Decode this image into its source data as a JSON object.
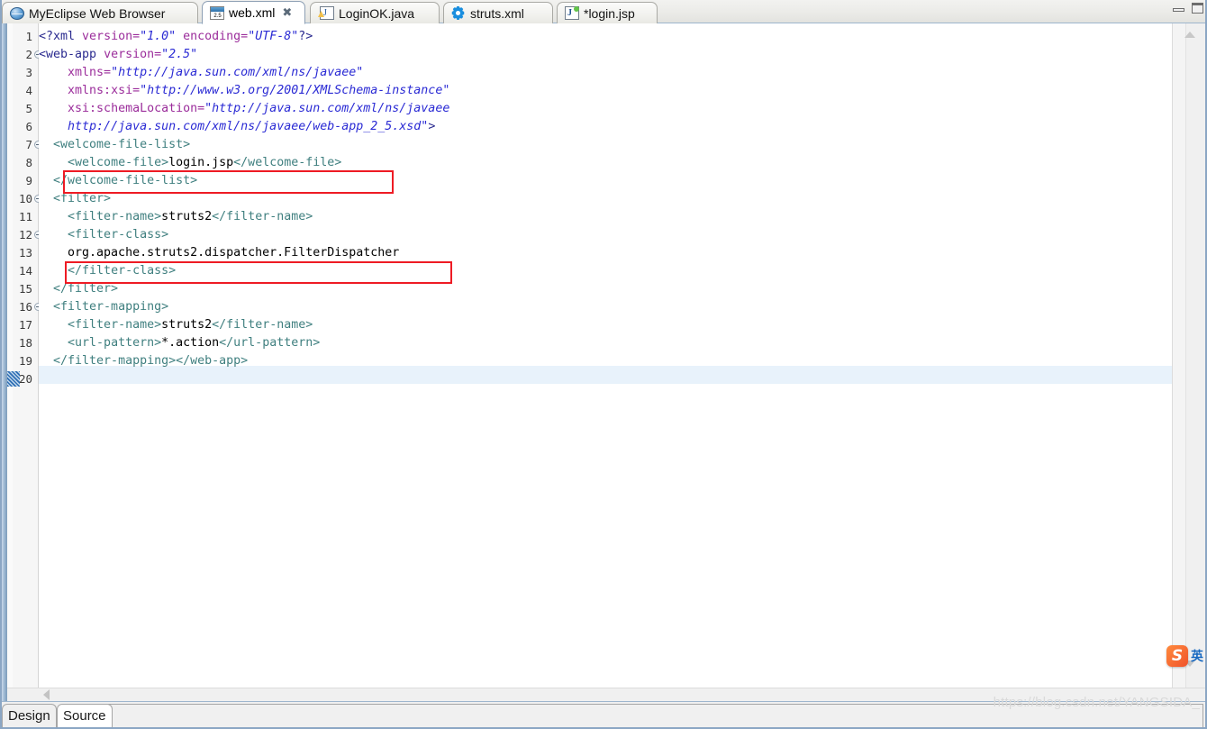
{
  "window": {
    "controls": [
      {
        "name": "minimize",
        "glyph": "—"
      },
      {
        "name": "maximize",
        "glyph": "□"
      }
    ]
  },
  "tabs": [
    {
      "label": "MyEclipse Web Browser",
      "icon": "globe-icon",
      "active": false,
      "dirty": false,
      "closable": false
    },
    {
      "label": "web.xml",
      "icon": "xml-file-icon",
      "active": true,
      "dirty": false,
      "closable": true,
      "close_glyph": "✖"
    },
    {
      "label": "LoginOK.java",
      "icon": "java-file-icon",
      "active": false,
      "dirty": false,
      "closable": false
    },
    {
      "label": "struts.xml",
      "icon": "gear-icon",
      "active": false,
      "dirty": false,
      "closable": false
    },
    {
      "label": "*login.jsp",
      "icon": "jsp-file-icon",
      "active": false,
      "dirty": true,
      "closable": false
    }
  ],
  "editor": {
    "current_line": 20,
    "line_numbers": [
      "1",
      "2",
      "3",
      "4",
      "5",
      "6",
      "7",
      "8",
      "9",
      "10",
      "11",
      "12",
      "13",
      "14",
      "15",
      "16",
      "17",
      "18",
      "19",
      "20"
    ],
    "fold_lines": [
      2,
      7,
      10,
      12,
      16
    ],
    "lines": [
      {
        "n": 1,
        "segments": [
          {
            "t": "<?xml ",
            "c": "pi"
          },
          {
            "t": "version=",
            "c": "at"
          },
          {
            "t": "\"1.0\"",
            "c": "va"
          },
          {
            "t": " ",
            "c": "txt"
          },
          {
            "t": "encoding=",
            "c": "at"
          },
          {
            "t": "\"UTF-8\"",
            "c": "va"
          },
          {
            "t": "?>",
            "c": "pi"
          }
        ]
      },
      {
        "n": 2,
        "segments": [
          {
            "t": "<web-app ",
            "c": "tgd"
          },
          {
            "t": "version=",
            "c": "at"
          },
          {
            "t": "\"2.5\"",
            "c": "va"
          }
        ]
      },
      {
        "n": 3,
        "segments": [
          {
            "t": "    ",
            "c": "txt"
          },
          {
            "t": "xmlns=",
            "c": "at"
          },
          {
            "t": "\"http://java.sun.com/xml/ns/javaee\"",
            "c": "va"
          }
        ]
      },
      {
        "n": 4,
        "segments": [
          {
            "t": "    ",
            "c": "txt"
          },
          {
            "t": "xmlns:xsi=",
            "c": "at"
          },
          {
            "t": "\"http://www.w3.org/2001/XMLSchema-instance\"",
            "c": "va"
          }
        ]
      },
      {
        "n": 5,
        "segments": [
          {
            "t": "    ",
            "c": "txt"
          },
          {
            "t": "xsi:schemaLocation=",
            "c": "at"
          },
          {
            "t": "\"http://java.sun.com/xml/ns/javaee",
            "c": "va"
          }
        ]
      },
      {
        "n": 6,
        "segments": [
          {
            "t": "    ",
            "c": "txt"
          },
          {
            "t": "http://java.sun.com/xml/ns/javaee/web-app_2_5.xsd\"",
            "c": "va"
          },
          {
            "t": ">",
            "c": "tgd"
          }
        ]
      },
      {
        "n": 7,
        "segments": [
          {
            "t": "  ",
            "c": "txt"
          },
          {
            "t": "<welcome-file-list>",
            "c": "tg"
          }
        ]
      },
      {
        "n": 8,
        "segments": [
          {
            "t": "    ",
            "c": "txt"
          },
          {
            "t": "<welcome-file>",
            "c": "tg"
          },
          {
            "t": "login.jsp",
            "c": "txt"
          },
          {
            "t": "</welcome-file>",
            "c": "tg"
          }
        ]
      },
      {
        "n": 9,
        "segments": [
          {
            "t": "  ",
            "c": "txt"
          },
          {
            "t": "</welcome-file-list>",
            "c": "tg"
          }
        ]
      },
      {
        "n": 10,
        "segments": [
          {
            "t": "  ",
            "c": "txt"
          },
          {
            "t": "<filter>",
            "c": "tg"
          }
        ]
      },
      {
        "n": 11,
        "segments": [
          {
            "t": "    ",
            "c": "txt"
          },
          {
            "t": "<filter-name>",
            "c": "tg"
          },
          {
            "t": "struts2",
            "c": "txt"
          },
          {
            "t": "</filter-name>",
            "c": "tg"
          }
        ]
      },
      {
        "n": 12,
        "segments": [
          {
            "t": "    ",
            "c": "txt"
          },
          {
            "t": "<filter-class>",
            "c": "tg"
          }
        ]
      },
      {
        "n": 13,
        "segments": [
          {
            "t": "    org.apache.struts2.dispatcher.FilterDispatcher",
            "c": "txt"
          }
        ]
      },
      {
        "n": 14,
        "segments": [
          {
            "t": "    ",
            "c": "txt"
          },
          {
            "t": "</filter-class>",
            "c": "tg"
          }
        ]
      },
      {
        "n": 15,
        "segments": [
          {
            "t": "  ",
            "c": "txt"
          },
          {
            "t": "</filter>",
            "c": "tg"
          }
        ]
      },
      {
        "n": 16,
        "segments": [
          {
            "t": "  ",
            "c": "txt"
          },
          {
            "t": "<filter-mapping>",
            "c": "tg"
          }
        ]
      },
      {
        "n": 17,
        "segments": [
          {
            "t": "    ",
            "c": "txt"
          },
          {
            "t": "<filter-name>",
            "c": "tg"
          },
          {
            "t": "struts2",
            "c": "txt"
          },
          {
            "t": "</filter-name>",
            "c": "tg"
          }
        ]
      },
      {
        "n": 18,
        "segments": [
          {
            "t": "    ",
            "c": "txt"
          },
          {
            "t": "<url-pattern>",
            "c": "tg"
          },
          {
            "t": "*.action",
            "c": "txt"
          },
          {
            "t": "</url-pattern>",
            "c": "tg"
          }
        ]
      },
      {
        "n": 19,
        "segments": [
          {
            "t": "  ",
            "c": "txt"
          },
          {
            "t": "</filter-mapping>",
            "c": "tg"
          },
          {
            "t": "</web-app>",
            "c": "tg"
          }
        ]
      },
      {
        "n": 20,
        "segments": [
          {
            "t": "",
            "c": "txt"
          }
        ]
      }
    ],
    "annotations": [
      {
        "name": "welcome-file-highlight",
        "target_line": 8,
        "color": "#ee1b24"
      },
      {
        "name": "filter-class-highlight",
        "target_line": 13,
        "color": "#ee1b24"
      }
    ]
  },
  "scrollbars": {
    "vertical": {
      "up_glyph": "▲",
      "down_glyph": "▼"
    },
    "horizontal": {
      "left_glyph": "◀"
    }
  },
  "ime": {
    "logo_letter": "S",
    "mode_label": "英"
  },
  "view_tabs": [
    {
      "label": "Design",
      "active": false
    },
    {
      "label": "Source",
      "active": true
    }
  ],
  "watermark": "https://blog.csdn.net/YANGSIDA_",
  "colors": {
    "tag": "#3f7f7f",
    "tag_dark": "#2a2a8f",
    "attribute": "#9b2d9b",
    "value": "#2a2ad4",
    "text": "#000000",
    "annotation": "#ee1b24",
    "current_line": "#e8f2fb",
    "chrome": "#f0f0f0"
  }
}
